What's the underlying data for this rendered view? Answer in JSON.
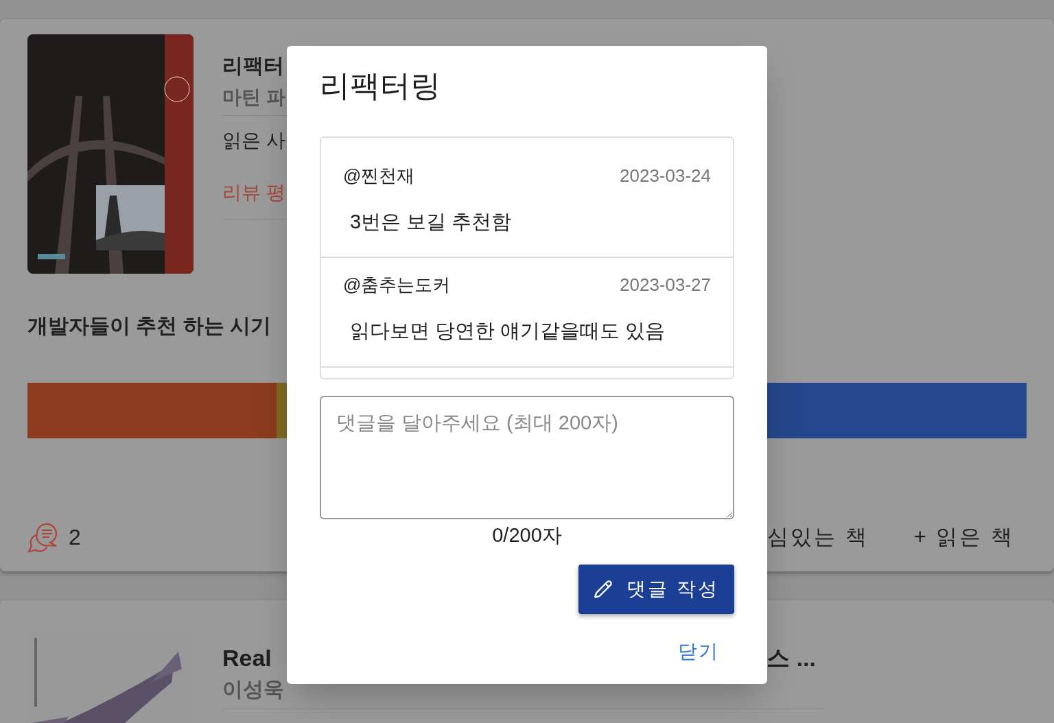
{
  "books": [
    {
      "title": "리팩터",
      "author": "마틴 파",
      "readers": "읽은 사",
      "review": "리뷰 평",
      "recommend_label": "개발자들이 추천 하는 시기",
      "comment_count": "2",
      "actions": [
        "심있는 책",
        "+ 읽은 책"
      ]
    },
    {
      "title": "Real",
      "title_tail": "스 ...",
      "author": "이성욱"
    }
  ],
  "dialog": {
    "title": "리팩터링",
    "comments": [
      {
        "user": "@찐천재",
        "date": "2023-03-24",
        "text": "3번은 보길 추천함"
      },
      {
        "user": "@춤추는도커",
        "date": "2023-03-27",
        "text": "읽다보면 당연한 얘기같을때도 있음"
      }
    ],
    "comment_field": {
      "placeholder": "댓글을 달아주세요 (최대 200자)"
    },
    "counter": "0/200자",
    "submit": "댓글 작성",
    "close": "닫기"
  }
}
